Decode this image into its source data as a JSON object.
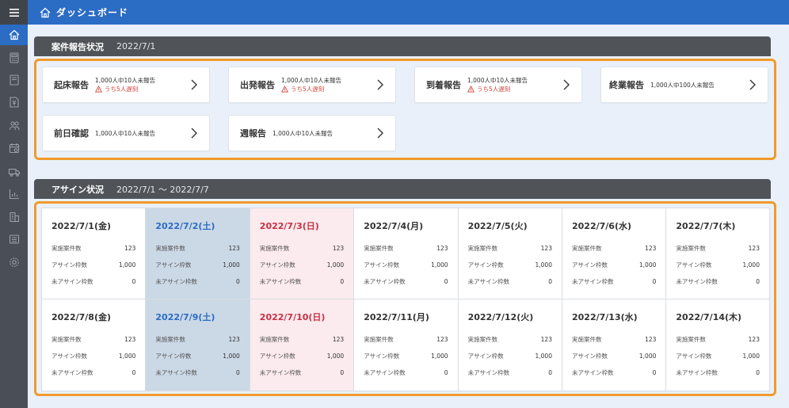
{
  "header": {
    "title": "ダッシュボード"
  },
  "sidebar": {
    "icons": [
      "menu-icon",
      "home-icon",
      "calculator-icon",
      "document-icon",
      "yen-file-icon",
      "people-icon",
      "calendar-icon",
      "truck-icon",
      "bar-chart-icon",
      "building-icon",
      "list-icon",
      "gear-icon"
    ]
  },
  "report_section": {
    "label": "案件報告状況",
    "date": "2022/7/1",
    "cards": [
      {
        "name": "起床報告",
        "line1": "1,000人中10人未報告",
        "warn": "うち5人遅刻"
      },
      {
        "name": "出発報告",
        "line1": "1,000人中10人未報告",
        "warn": "うち5人遅刻"
      },
      {
        "name": "到着報告",
        "line1": "1,000人中10人未報告",
        "warn": "うち5人遅刻"
      },
      {
        "name": "終業報告",
        "line1": "1,000人中100人未報告",
        "warn": ""
      },
      {
        "name": "前日確認",
        "line1": "1,000人中10人未報告",
        "warn": ""
      },
      {
        "name": "週報告",
        "line1": "1,000人中10人未報告",
        "warn": ""
      }
    ]
  },
  "assign_section": {
    "label": "アサイン状況",
    "date": "2022/7/1 ～ 2022/7/7",
    "row_labels": {
      "cases": "実施案件数",
      "slots": "アサイン枠数",
      "unassigned": "未アサイン枠数"
    },
    "days": [
      {
        "date": "2022/7/1(金)",
        "type": "weekday",
        "cases": "123",
        "slots": "1,000",
        "unassigned": "0"
      },
      {
        "date": "2022/7/2(土)",
        "type": "sat",
        "cases": "123",
        "slots": "1,000",
        "unassigned": "0"
      },
      {
        "date": "2022/7/3(日)",
        "type": "sun",
        "cases": "123",
        "slots": "1,000",
        "unassigned": "0"
      },
      {
        "date": "2022/7/4(月)",
        "type": "weekday",
        "cases": "123",
        "slots": "1,000",
        "unassigned": "0"
      },
      {
        "date": "2022/7/5(火)",
        "type": "weekday",
        "cases": "123",
        "slots": "1,000",
        "unassigned": "0"
      },
      {
        "date": "2022/7/6(水)",
        "type": "weekday",
        "cases": "123",
        "slots": "1,000",
        "unassigned": "0"
      },
      {
        "date": "2022/7/7(木)",
        "type": "weekday",
        "cases": "123",
        "slots": "1,000",
        "unassigned": "0"
      },
      {
        "date": "2022/7/8(金)",
        "type": "weekday",
        "cases": "123",
        "slots": "1,000",
        "unassigned": "0"
      },
      {
        "date": "2022/7/9(土)",
        "type": "sat",
        "cases": "123",
        "slots": "1,000",
        "unassigned": "0"
      },
      {
        "date": "2022/7/10(日)",
        "type": "sun",
        "cases": "123",
        "slots": "1,000",
        "unassigned": "0"
      },
      {
        "date": "2022/7/11(月)",
        "type": "weekday",
        "cases": "123",
        "slots": "1,000",
        "unassigned": "0"
      },
      {
        "date": "2022/7/12(火)",
        "type": "weekday",
        "cases": "123",
        "slots": "1,000",
        "unassigned": "0"
      },
      {
        "date": "2022/7/13(水)",
        "type": "weekday",
        "cases": "123",
        "slots": "1,000",
        "unassigned": "0"
      },
      {
        "date": "2022/7/14(木)",
        "type": "weekday",
        "cases": "123",
        "slots": "1,000",
        "unassigned": "0"
      }
    ]
  },
  "colors": {
    "brand": "#2b6cc4",
    "highlight": "#f19a2c",
    "warning": "#d2463c",
    "saturday": "#cbd8e6",
    "sunday": "#fbeaee"
  }
}
